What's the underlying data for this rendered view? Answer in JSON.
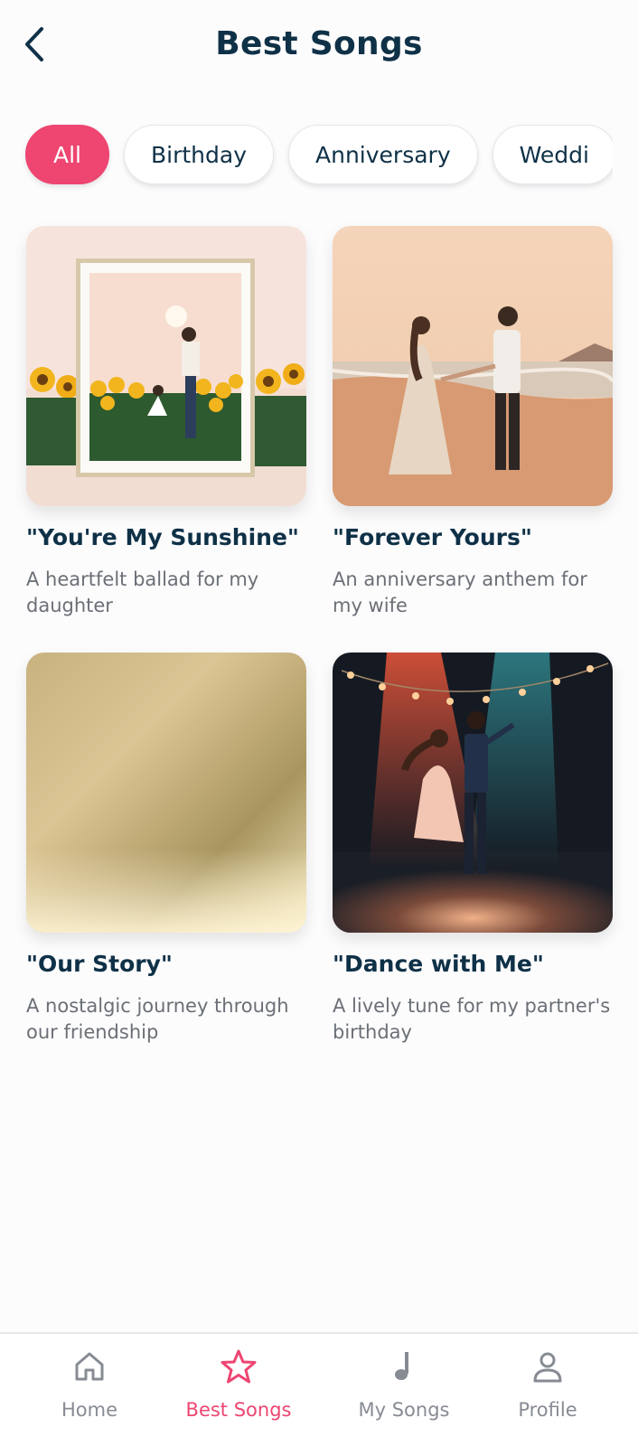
{
  "header": {
    "title": "Best Songs",
    "back_icon": "chevron-left-icon"
  },
  "filters": [
    {
      "label": "All",
      "active": true
    },
    {
      "label": "Birthday",
      "active": false
    },
    {
      "label": "Anniversary",
      "active": false
    },
    {
      "label": "Weddi",
      "active": false
    }
  ],
  "songs": [
    {
      "title": "\"You're My Sunshine\"",
      "description": "A heartfelt ballad for my daughter",
      "image": "framed picture of father and daughter in sunflower field"
    },
    {
      "title": "\"Forever Yours\"",
      "description": "An anniversary anthem for my wife",
      "image": "couple walking hand in hand on beach"
    },
    {
      "title": "\"Our Story\"",
      "description": "A nostalgic journey through our friendship",
      "image": "gold gradient"
    },
    {
      "title": "\"Dance with Me\"",
      "description": "A lively tune for my partner's birthday",
      "image": "couple dancing under spotlights"
    }
  ],
  "nav": [
    {
      "label": "Home",
      "icon": "home-icon",
      "active": false
    },
    {
      "label": "Best Songs",
      "icon": "star-icon",
      "active": true
    },
    {
      "label": "My Songs",
      "icon": "music-note-icon",
      "active": false
    },
    {
      "label": "Profile",
      "icon": "person-icon",
      "active": false
    }
  ],
  "colors": {
    "accent": "#ee4571",
    "title": "#0f3147",
    "muted": "#878b93",
    "background": "#fcfcfd"
  }
}
